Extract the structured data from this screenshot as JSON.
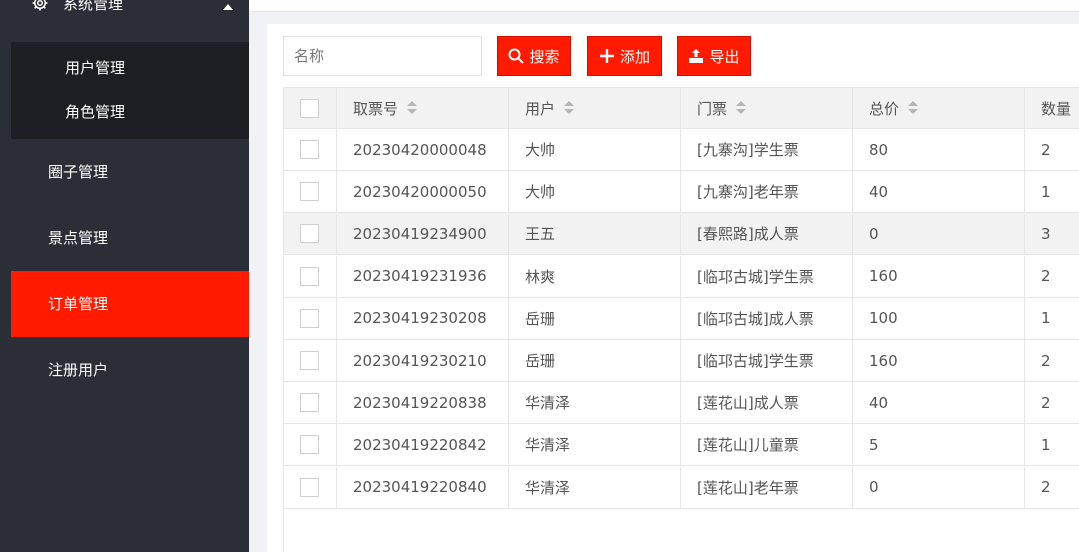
{
  "sidebar": {
    "system_title": "系统管理",
    "submenu": [
      "用户管理",
      "角色管理"
    ],
    "items": [
      "圈子管理",
      "景点管理",
      "订单管理",
      "注册用户"
    ],
    "active_index": 2
  },
  "toolbar": {
    "search_placeholder": "名称",
    "search_label": "搜索",
    "add_label": "添加",
    "export_label": "导出"
  },
  "table": {
    "columns": [
      "取票号",
      "用户",
      "门票",
      "总价",
      "数量"
    ],
    "rows": [
      [
        "20230420000048",
        "大帅",
        "[九寨沟]学生票",
        "80",
        "2"
      ],
      [
        "20230420000050",
        "大帅",
        "[九寨沟]老年票",
        "40",
        "1"
      ],
      [
        "20230419234900",
        "王五",
        "[春熙路]成人票",
        "0",
        "3"
      ],
      [
        "20230419231936",
        "林爽",
        "[临邛古城]学生票",
        "160",
        "2"
      ],
      [
        "20230419230208",
        "岳珊",
        "[临邛古城]成人票",
        "100",
        "1"
      ],
      [
        "20230419230210",
        "岳珊",
        "[临邛古城]学生票",
        "160",
        "2"
      ],
      [
        "20230419220838",
        "华清泽",
        "[莲花山]成人票",
        "40",
        "2"
      ],
      [
        "20230419220842",
        "华清泽",
        "[莲花山]儿童票",
        "5",
        "1"
      ],
      [
        "20230419220840",
        "华清泽",
        "[莲花山]老年票",
        "0",
        "2"
      ]
    ]
  },
  "colors": {
    "accent": "#ff1a00",
    "sidebar_bg": "#2b2e36",
    "submenu_bg": "#1d1f24"
  }
}
